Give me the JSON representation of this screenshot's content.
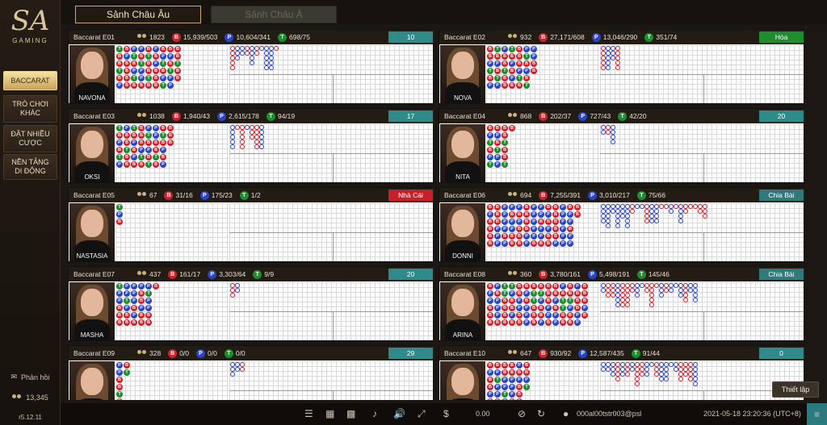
{
  "sidebar": {
    "logo_mark": "SA",
    "logo_sub": "GAMING",
    "items": [
      {
        "label": "BACCARAT"
      },
      {
        "label": "TRÒ CHƠI KHÁC"
      },
      {
        "label": "ĐẶT NHIỀU CƯỢC"
      },
      {
        "label": "NỀN TẢNG DI ĐỘNG"
      }
    ],
    "feedback": "Phản hồi",
    "online_count": "13,345",
    "version": "r5.12.11"
  },
  "tabs": [
    {
      "label": "Sảnh Châu Âu"
    },
    {
      "label": "Sảnh Châu Á"
    }
  ],
  "tables": [
    {
      "name": "Baccarat E01",
      "players": "1823",
      "banker": "15,939/503",
      "player": "10,604/341",
      "tie": "698/75",
      "status": "10",
      "dealer": "NAVONA"
    },
    {
      "name": "Baccarat E02",
      "players": "932",
      "banker": "27,171/608",
      "player": "13,046/290",
      "tie": "351/74",
      "status": "Hòa",
      "dealer": "NOVA"
    },
    {
      "name": "Baccarat E03",
      "players": "1038",
      "banker": "1,940/43",
      "player": "2,615/178",
      "tie": "94/19",
      "status": "17",
      "dealer": "OKSI"
    },
    {
      "name": "Baccarat E04",
      "players": "868",
      "banker": "202/37",
      "player": "727/43",
      "tie": "42/20",
      "status": "20",
      "dealer": "NITA"
    },
    {
      "name": "Baccarat E05",
      "players": "67",
      "banker": "31/16",
      "player": "175/23",
      "tie": "1/2",
      "status": "Nhà Cái",
      "dealer": "NASTASIA"
    },
    {
      "name": "Baccarat E06",
      "players": "694",
      "banker": "7,255/391",
      "player": "3,010/217",
      "tie": "75/66",
      "status": "Chia Bài",
      "dealer": "DONNI"
    },
    {
      "name": "Baccarat E07",
      "players": "437",
      "banker": "161/17",
      "player": "3,303/64",
      "tie": "9/9",
      "status": "20",
      "dealer": "MASHA"
    },
    {
      "name": "Baccarat E08",
      "players": "360",
      "banker": "3,780/161",
      "player": "5,498/191",
      "tie": "145/46",
      "status": "Chia Bài",
      "dealer": "ARINA"
    },
    {
      "name": "Baccarat E09",
      "players": "328",
      "banker": "0/0",
      "player": "0/0",
      "tie": "0/0",
      "status": "29",
      "dealer": ""
    },
    {
      "name": "Baccarat E10",
      "players": "647",
      "banker": "930/92",
      "player": "12,587/435",
      "tie": "91/44",
      "status": "0",
      "dealer": ""
    }
  ],
  "status_colors": {
    "count": "#2f8a8a",
    "tie": "#1f8c2e",
    "banker": "#c8202a",
    "dealing": "#2f7a7a",
    "zero": "#2f8a8a"
  },
  "bottom": {
    "balance": "0.00",
    "user": "000al00tstr003@psl",
    "datetime": "2021-05-18  23:20:36 (UTC+8)"
  },
  "settings_label": "Thiết lập",
  "bead_letters": {
    "banker": "B",
    "player": "P",
    "tie": "T"
  }
}
